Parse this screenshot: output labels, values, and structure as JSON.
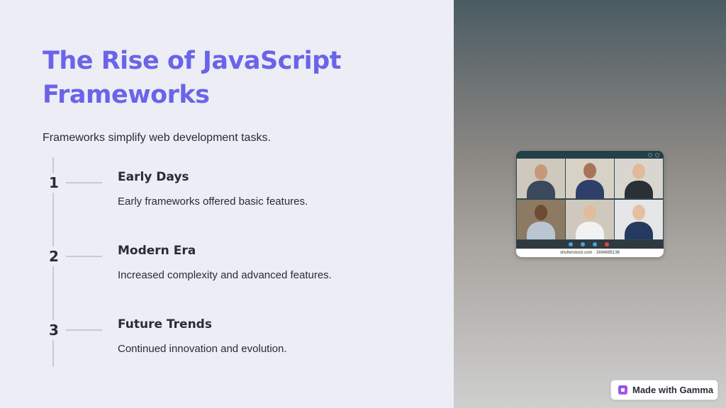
{
  "slide": {
    "title": "The Rise of JavaScript Frameworks",
    "subtitle": "Frameworks simplify web development tasks.",
    "steps": [
      {
        "number": "1",
        "title": "Early Days",
        "description": "Early frameworks offered basic features."
      },
      {
        "number": "2",
        "title": "Modern Era",
        "description": "Increased complexity and advanced features."
      },
      {
        "number": "3",
        "title": "Future Trends",
        "description": "Continued innovation and evolution."
      }
    ],
    "accent_color": "#6a64e8"
  },
  "image": {
    "caption": "shutterstock.com · 1694685136"
  },
  "badge": {
    "label": "Made with Gamma",
    "icon": "gamma-logo-icon"
  }
}
